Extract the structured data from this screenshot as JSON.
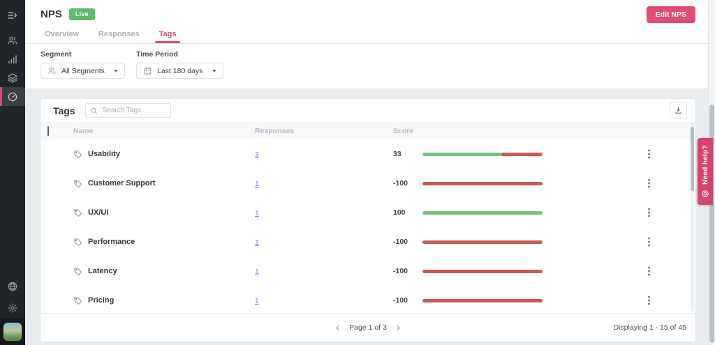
{
  "app": {
    "title": "NPS",
    "status_badge": "Live",
    "edit_button": "Edit NPS"
  },
  "tabs": [
    {
      "label": "Overview",
      "active": false
    },
    {
      "label": "Responses",
      "active": false
    },
    {
      "label": "Tags",
      "active": true
    }
  ],
  "filters": {
    "segment_label": "Segment",
    "segment_value": "All Segments",
    "time_period_label": "Time Period",
    "time_period_value": "Last 180 days"
  },
  "tags_card": {
    "title": "Tags",
    "search_placeholder": "Search Tags..",
    "columns": {
      "name": "Name",
      "responses": "Responses",
      "score": "Score"
    },
    "rows": [
      {
        "name": "Usability",
        "responses": "3",
        "score": "33",
        "green_pct": 66.5,
        "red_pct": 33.5
      },
      {
        "name": "Customer Support",
        "responses": "1",
        "score": "-100",
        "green_pct": 0,
        "red_pct": 100
      },
      {
        "name": "UX/UI",
        "responses": "1",
        "score": "100",
        "green_pct": 100,
        "red_pct": 0
      },
      {
        "name": "Performance",
        "responses": "1",
        "score": "-100",
        "green_pct": 0,
        "red_pct": 100
      },
      {
        "name": "Latency",
        "responses": "1",
        "score": "-100",
        "green_pct": 0,
        "red_pct": 100
      },
      {
        "name": "Pricing",
        "responses": "1",
        "score": "-100",
        "green_pct": 0,
        "red_pct": 100
      }
    ],
    "pagination": {
      "page_text": "Page 1 of 3",
      "displaying_text": "Displaying 1 - 15 of 45"
    }
  },
  "help_tab": {
    "label": "Need help?"
  },
  "sidebar": {
    "icons": [
      "menu-toggle-icon",
      "users-icon",
      "bar-chart-icon",
      "layers-icon",
      "gauge-icon",
      "globe-icon",
      "settings-icon",
      "user-avatar"
    ],
    "active_icon": "gauge-icon"
  },
  "colors": {
    "accent_pink": "#e04a73",
    "live_green": "#5dbb6c",
    "bar_green": "#79c27e",
    "bar_red": "#cc5a54",
    "link_purple": "#7d84e6",
    "sidebar_bg": "#22262a"
  }
}
